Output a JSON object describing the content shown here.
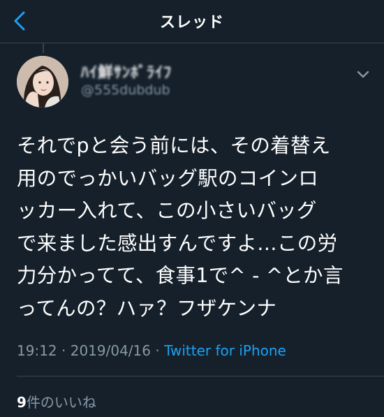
{
  "header": {
    "title": "スレッド",
    "back_icon": "chevron-left-icon"
  },
  "tweet": {
    "display_name": "ﾊｲ鮮ｻﾝﾎﾞﾗｲﾌ",
    "handle": "@555dubdub",
    "text": "それでpと会う前には、その着替え\n用のでっかいバッグ駅のコインロ\nッカー入れて、この小さいバッグ\nで来ました感出すんですよ…この労\n力分かってて、食事1で^ - ^とか言\nってんの？ハァ？フザケンナ",
    "time": "19:12",
    "separator1": " · ",
    "date": "2019/04/16",
    "separator2": " · ",
    "source": "Twitter for iPhone",
    "likes_count": "9",
    "likes_label": "件のいいね"
  },
  "colors": {
    "background": "#15202b",
    "text": "#ffffff",
    "secondary": "#8899a6",
    "accent": "#1da1f2",
    "divider": "#38444d"
  }
}
